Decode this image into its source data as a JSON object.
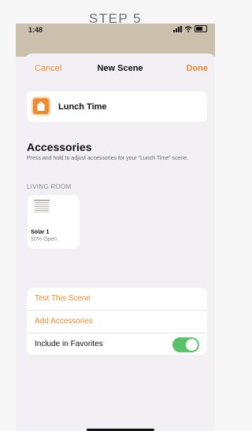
{
  "step_label": "STEP 5",
  "status": {
    "time": "1:48"
  },
  "nav": {
    "cancel": "Cancel",
    "title": "New Scene",
    "done": "Done"
  },
  "scene": {
    "name": "Lunch Time",
    "icon": "home-icon",
    "accent": "#ef8a2f"
  },
  "accessories": {
    "title": "Accessories",
    "subtitle": "Press and hold to adjust accessories for your “Lunch Time” scene.",
    "room": "LIVING ROOM",
    "items": [
      {
        "name": "Solar 1",
        "state": "50% Open",
        "icon": "window-blind-icon"
      }
    ]
  },
  "options": {
    "test": "Test This Scene",
    "add": "Add Accessories",
    "favorites": "Include in Favorites",
    "favorites_on": true
  },
  "colors": {
    "accent": "#ee8b2a",
    "toggle_on": "#5ac36a",
    "status_bar": "#cbbfae"
  }
}
